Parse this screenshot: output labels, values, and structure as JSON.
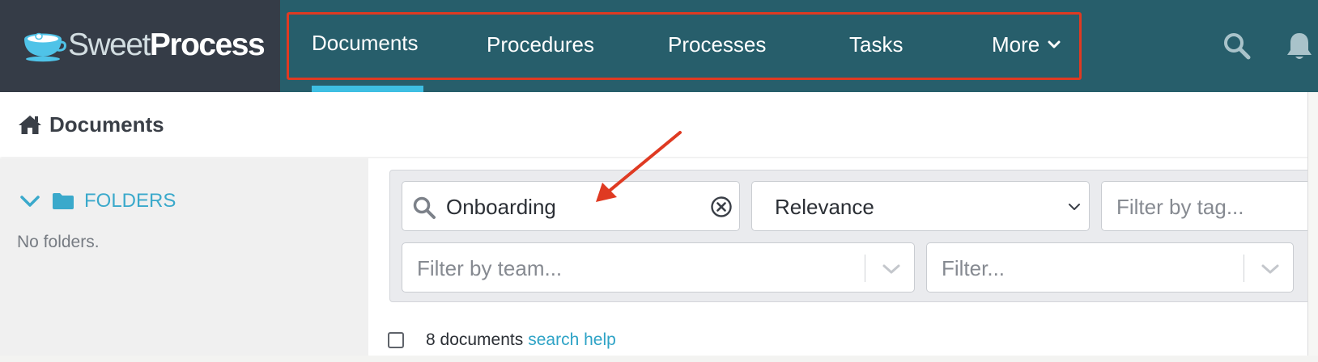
{
  "app": {
    "brand_part1": "Sweet",
    "brand_part2": "Process"
  },
  "nav": {
    "items": [
      {
        "label": "Documents",
        "active": true
      },
      {
        "label": "Procedures",
        "active": false
      },
      {
        "label": "Processes",
        "active": false
      },
      {
        "label": "Tasks",
        "active": false
      },
      {
        "label": "More",
        "active": false,
        "icon": "chevron-down-icon"
      }
    ],
    "right_icons": [
      "search-icon",
      "bell-icon"
    ]
  },
  "breadcrumb": {
    "icon": "home-icon",
    "title": "Documents"
  },
  "sidebar": {
    "folders_icon": "folder-icon",
    "folders_label": "FOLDERS",
    "empty_text": "No folders."
  },
  "filters": {
    "search": {
      "value": "Onboarding",
      "icon": "search-icon",
      "clear_icon": "clear-circle-icon"
    },
    "sort": {
      "selected": "Relevance"
    },
    "tag": {
      "placeholder": "Filter by tag..."
    },
    "team": {
      "placeholder": "Filter by team..."
    },
    "generic": {
      "placeholder": "Filter..."
    }
  },
  "results": {
    "count_text": "8 documents",
    "help_link": "search help"
  },
  "colors": {
    "nav_bg": "#275e6b",
    "logo_bg": "#353c47",
    "active_indicator": "#3ebfe3",
    "link": "#2ea3c6",
    "annotation": "#df3a22"
  }
}
